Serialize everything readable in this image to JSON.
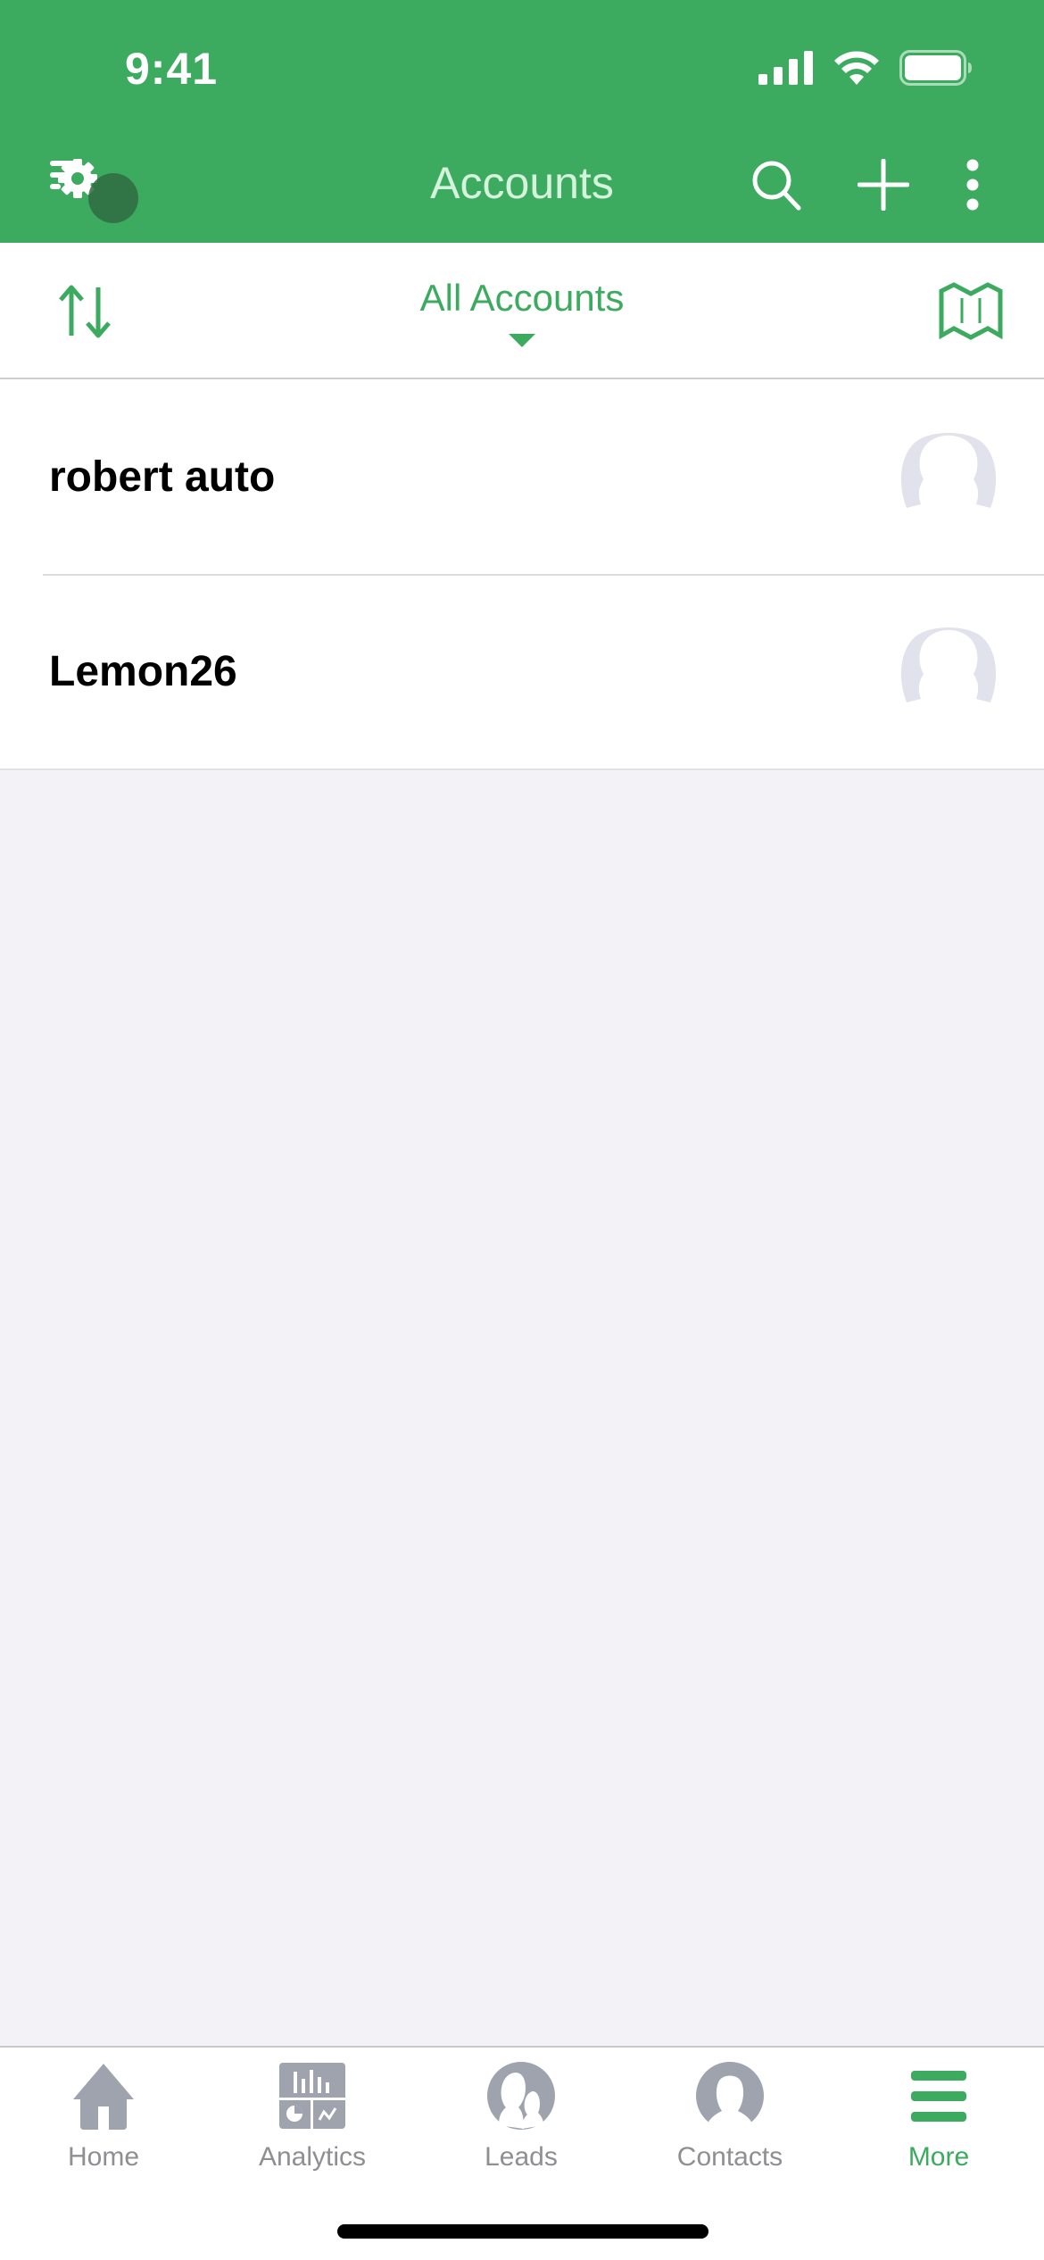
{
  "status_bar": {
    "time": "9:41",
    "icons": [
      "cellular-signal-icon",
      "wifi-icon",
      "battery-icon"
    ]
  },
  "nav_bar": {
    "title": "Accounts",
    "left_icon": "filter-settings-icon",
    "right_icons": [
      "search-icon",
      "add-icon",
      "more-vertical-icon"
    ]
  },
  "filter_bar": {
    "sort_icon": "sort-icon",
    "view_label": "All Accounts",
    "map_icon": "map-icon"
  },
  "accounts": [
    {
      "name": "robert auto"
    },
    {
      "name": "Lemon26"
    }
  ],
  "tab_bar": {
    "tabs": [
      {
        "label": "Home",
        "icon": "home-icon",
        "active": false
      },
      {
        "label": "Analytics",
        "icon": "analytics-icon",
        "active": false
      },
      {
        "label": "Leads",
        "icon": "leads-icon",
        "active": false
      },
      {
        "label": "Contacts",
        "icon": "contacts-icon",
        "active": false
      },
      {
        "label": "More",
        "icon": "menu-icon",
        "active": true
      }
    ]
  },
  "colors": {
    "brand": "#3dab5f",
    "inactive": "#8e8e93",
    "icon_gray": "#9ea3ae",
    "background": "#f2f2f7"
  }
}
